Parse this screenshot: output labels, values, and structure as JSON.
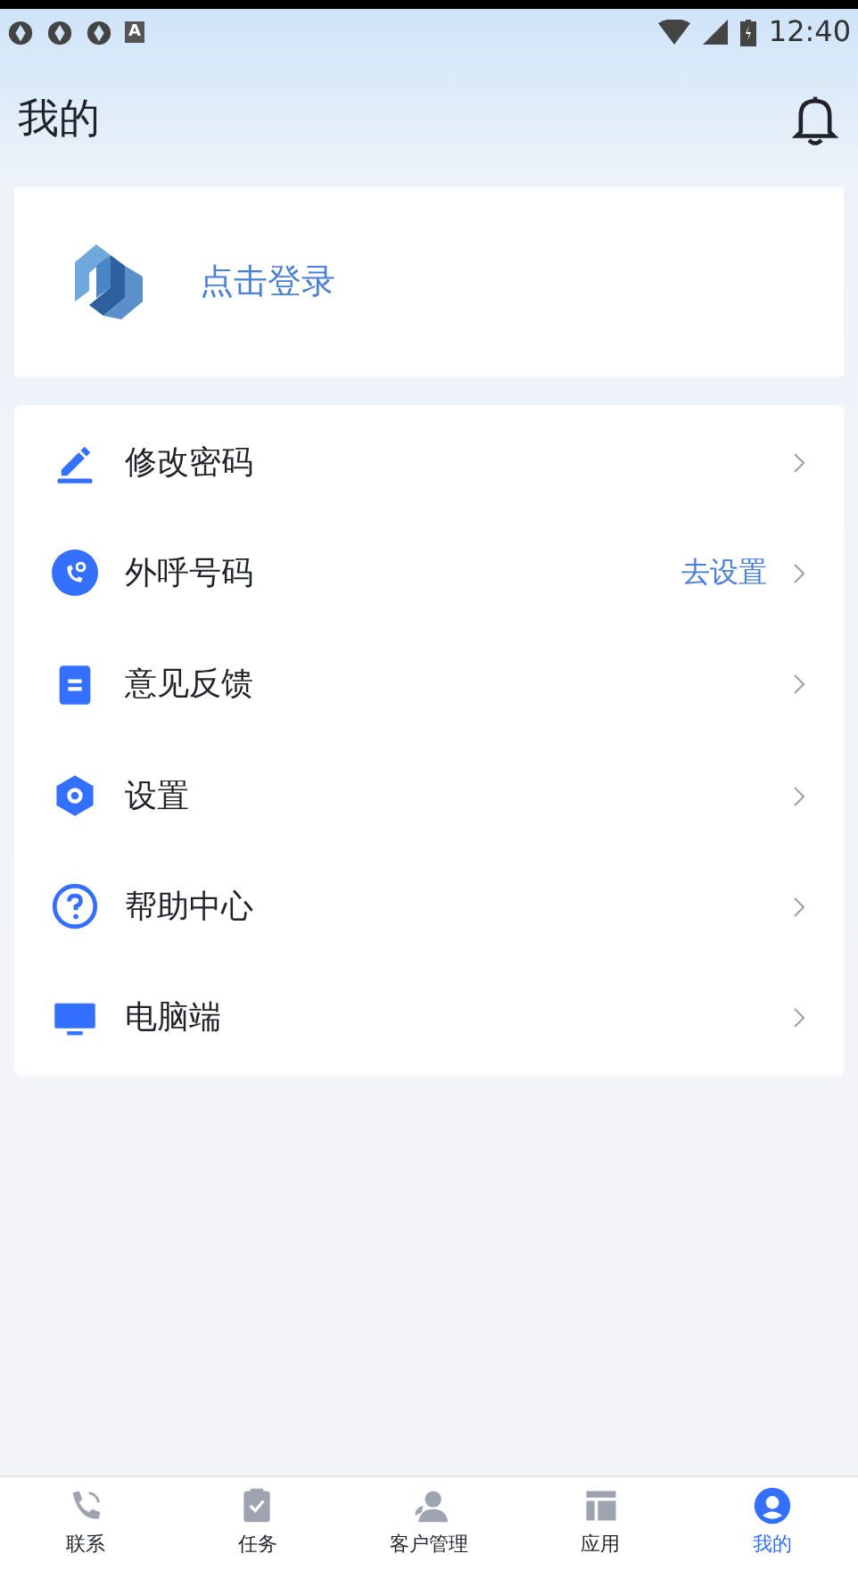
{
  "status_bar": {
    "time": "12:40",
    "badge": "A"
  },
  "header": {
    "title": "我的"
  },
  "login_card": {
    "label": "点击登录"
  },
  "menu": [
    {
      "label": "修改密码"
    },
    {
      "label": "外呼号码",
      "action": "去设置"
    },
    {
      "label": "意见反馈"
    },
    {
      "label": "设置"
    },
    {
      "label": "帮助中心"
    },
    {
      "label": "电脑端"
    }
  ],
  "tabs": [
    {
      "label": "联系",
      "selected": false
    },
    {
      "label": "任务",
      "selected": false
    },
    {
      "label": "客户管理",
      "selected": false
    },
    {
      "label": "应用",
      "selected": false
    },
    {
      "label": "我的",
      "selected": true
    }
  ]
}
